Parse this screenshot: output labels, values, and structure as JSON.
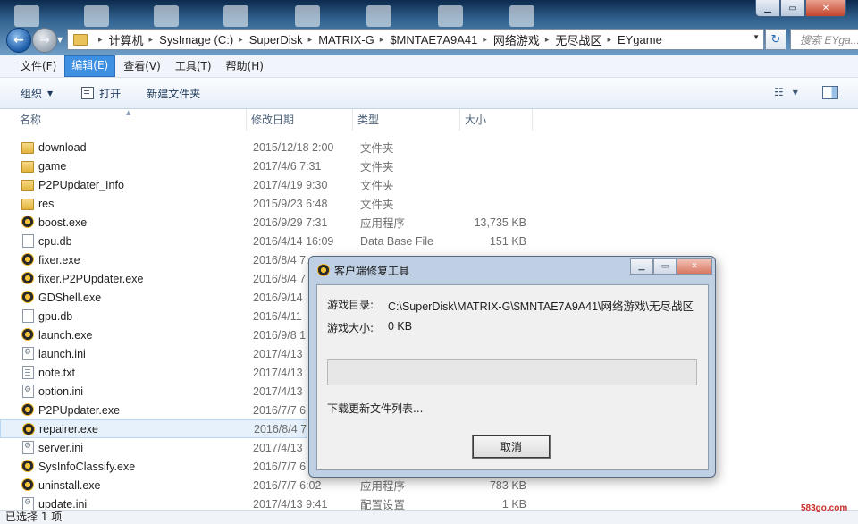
{
  "window": {
    "controls": [
      "minimize",
      "maximize",
      "close"
    ]
  },
  "navigation": {
    "back_icon": "back-arrow-icon",
    "forward_icon": "forward-arrow-icon"
  },
  "address_bar": {
    "crumbs": [
      "计算机",
      "SysImage (C:)",
      "SuperDisk",
      "MATRIX-G",
      "$MNTAE7A9A41",
      "网络游戏",
      "无尽战区",
      "EYgame"
    ]
  },
  "search": {
    "placeholder": "搜索 EYga..."
  },
  "menu": {
    "items": [
      "文件(F)",
      "编辑(E)",
      "查看(V)",
      "工具(T)",
      "帮助(H)"
    ],
    "active_index": 1
  },
  "toolbar": {
    "organize_label": "组织",
    "open_label": "打开",
    "new_folder_label": "新建文件夹"
  },
  "columns": {
    "name": "名称",
    "date": "修改日期",
    "type": "类型",
    "size": "大小"
  },
  "files": [
    {
      "name": "download",
      "date": "2015/12/18 2:00",
      "type": "文件夹",
      "size": "",
      "icon": "folder-icon"
    },
    {
      "name": "game",
      "date": "2017/4/6 7:31",
      "type": "文件夹",
      "size": "",
      "icon": "folder-icon"
    },
    {
      "name": "P2PUpdater_Info",
      "date": "2017/4/19 9:30",
      "type": "文件夹",
      "size": "",
      "icon": "folder-icon"
    },
    {
      "name": "res",
      "date": "2015/9/23 6:48",
      "type": "文件夹",
      "size": "",
      "icon": "folder-icon"
    },
    {
      "name": "boost.exe",
      "date": "2016/9/29 7:31",
      "type": "应用程序",
      "size": "13,735 KB",
      "icon": "app-icon"
    },
    {
      "name": "cpu.db",
      "date": "2016/4/14 16:09",
      "type": "Data Base File",
      "size": "151 KB",
      "icon": "db-file-icon"
    },
    {
      "name": "fixer.exe",
      "date": "2016/8/4 7:",
      "type": "",
      "size": "",
      "icon": "app-icon"
    },
    {
      "name": "fixer.P2PUpdater.exe",
      "date": "2016/8/4 7",
      "type": "",
      "size": "",
      "icon": "app-icon"
    },
    {
      "name": "GDShell.exe",
      "date": "2016/9/14",
      "type": "",
      "size": "",
      "icon": "app-icon"
    },
    {
      "name": "gpu.db",
      "date": "2016/4/11",
      "type": "",
      "size": "",
      "icon": "db-file-icon"
    },
    {
      "name": "launch.exe",
      "date": "2016/9/8 1",
      "type": "",
      "size": "",
      "icon": "app-icon"
    },
    {
      "name": "launch.ini",
      "date": "2017/4/13",
      "type": "",
      "size": "",
      "icon": "ini-file-icon"
    },
    {
      "name": "note.txt",
      "date": "2017/4/13",
      "type": "",
      "size": "",
      "icon": "text-file-icon"
    },
    {
      "name": "option.ini",
      "date": "2017/4/13",
      "type": "",
      "size": "",
      "icon": "ini-file-icon"
    },
    {
      "name": "P2PUpdater.exe",
      "date": "2016/7/7 6",
      "type": "",
      "size": "",
      "icon": "app-icon"
    },
    {
      "name": "repairer.exe",
      "date": "2016/8/4 7",
      "type": "",
      "size": "",
      "icon": "app-icon",
      "selected": true
    },
    {
      "name": "server.ini",
      "date": "2017/4/13",
      "type": "",
      "size": "",
      "icon": "ini-file-icon"
    },
    {
      "name": "SysInfoClassify.exe",
      "date": "2016/7/7 6",
      "type": "",
      "size": "",
      "icon": "app-icon"
    },
    {
      "name": "uninstall.exe",
      "date": "2016/7/7 6:02",
      "type": "应用程序",
      "size": "783 KB",
      "icon": "app-icon"
    },
    {
      "name": "update.ini",
      "date": "2017/4/13 9:41",
      "type": "配置设置",
      "size": "1 KB",
      "icon": "ini-file-icon"
    }
  ],
  "status": {
    "selection_text": "已选择 1 项"
  },
  "watermark": "583go.com",
  "dialog": {
    "title": "客户端修复工具",
    "game_dir_label": "游戏目录:",
    "game_dir_value": "C:\\SuperDisk\\MATRIX-G\\$MNTAE7A9A41\\网络游戏\\无尽战区",
    "game_size_label": "游戏大小:",
    "game_size_value": "0 KB",
    "progress_fraction": 0,
    "status_text": "下载更新文件列表...",
    "cancel_label": "取消",
    "progress_color": "#3aa53a"
  }
}
